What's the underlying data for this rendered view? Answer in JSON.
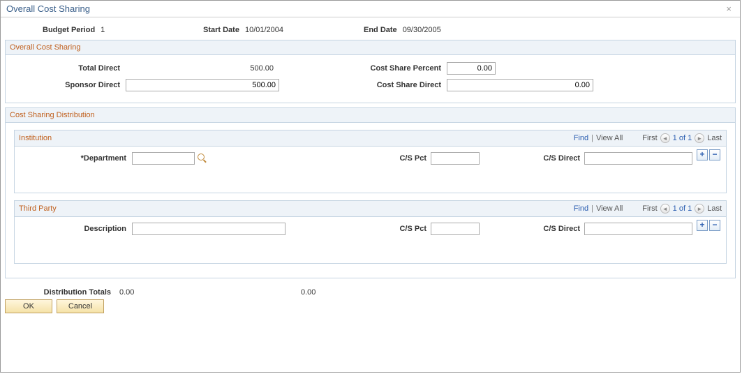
{
  "dialog": {
    "title": "Overall Cost Sharing",
    "close_label": "×"
  },
  "info": {
    "budget_period_label": "Budget Period",
    "budget_period_value": "1",
    "start_date_label": "Start Date",
    "start_date_value": "10/01/2004",
    "end_date_label": "End Date",
    "end_date_value": "09/30/2005"
  },
  "ocs": {
    "header": "Overall Cost Sharing",
    "total_direct_label": "Total Direct",
    "total_direct_value": "500.00",
    "sponsor_direct_label": "Sponsor Direct",
    "sponsor_direct_value": "500.00",
    "cost_share_percent_label": "Cost Share Percent",
    "cost_share_percent_value": "0.00",
    "cost_share_direct_label": "Cost Share Direct",
    "cost_share_direct_value": "0.00"
  },
  "dist": {
    "header": "Cost Sharing Distribution",
    "nav": {
      "find": "Find",
      "view_all": "View All",
      "first": "First",
      "of": "1 of 1",
      "last": "Last",
      "prev_glyph": "◄",
      "next_glyph": "►"
    },
    "institution": {
      "title": "Institution",
      "department_label": "*Department",
      "department_value": "",
      "cs_pct_label": "C/S Pct",
      "cs_pct_value": "",
      "cs_direct_label": "C/S Direct",
      "cs_direct_value": "",
      "add_glyph": "+",
      "remove_glyph": "−"
    },
    "third_party": {
      "title": "Third Party",
      "description_label": "Description",
      "description_value": "",
      "cs_pct_label": "C/S Pct",
      "cs_pct_value": "",
      "cs_direct_label": "C/S Direct",
      "cs_direct_value": "",
      "add_glyph": "+",
      "remove_glyph": "−"
    }
  },
  "totals": {
    "label": "Distribution Totals",
    "val1": "0.00",
    "val2": "0.00"
  },
  "buttons": {
    "ok": "OK",
    "cancel": "Cancel"
  }
}
